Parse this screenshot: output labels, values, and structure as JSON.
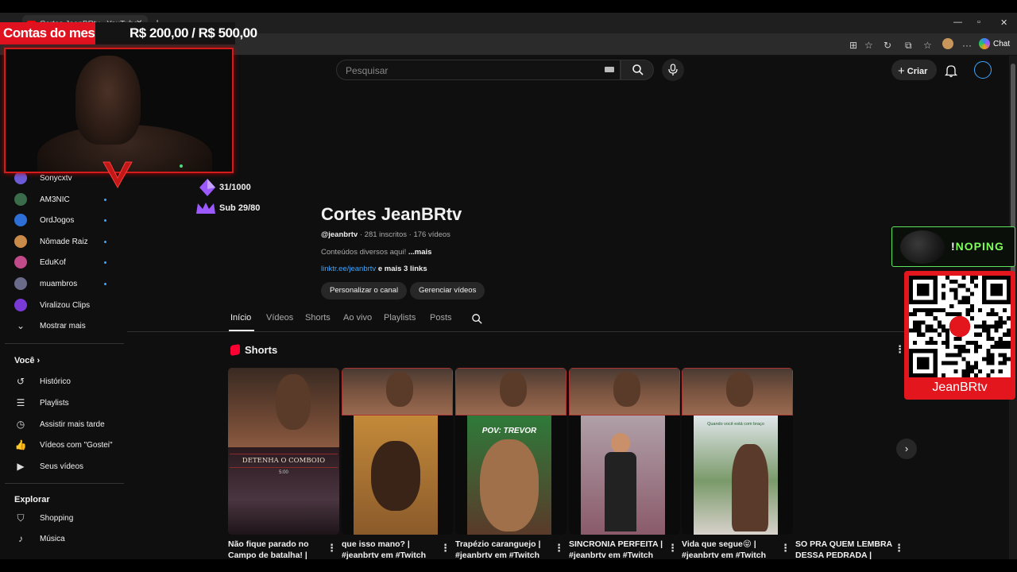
{
  "browser": {
    "tab_title": "Cortes JeanBRtv - YouTube",
    "chat_label": "Chat"
  },
  "overlay": {
    "bills_label": "Contas do mes",
    "bills_value": "R$ 200,00 / R$ 500,00",
    "goal_followers": "31/1000",
    "goal_subs": "Sub 29/80",
    "noping_label": "!NOPING",
    "noping_exclaim": "!",
    "noping_word": "NOPING",
    "qr_caption": "JeanBRtv"
  },
  "header": {
    "search_placeholder": "Pesquisar",
    "create_label": "Criar"
  },
  "sidebar": {
    "subscriptions": [
      {
        "name": "Sonycxtv",
        "color": "#6b5bd6"
      },
      {
        "name": "AM3NIC",
        "color": "#3a6b4a"
      },
      {
        "name": "OrdJogos",
        "color": "#2d6fd6"
      },
      {
        "name": "Nômade Raiz",
        "color": "#c98a4a"
      },
      {
        "name": "EduKof",
        "color": "#c04a8a"
      },
      {
        "name": "muambros",
        "color": "#6a6a8a"
      },
      {
        "name": "Viralizou Clips",
        "color": "#7a3ad6"
      }
    ],
    "show_more": "Mostrar mais",
    "you_heading": "Você",
    "you_items": [
      "Histórico",
      "Playlists",
      "Assistir mais tarde",
      "Vídeos com \"Gostei\"",
      "Seus vídeos"
    ],
    "explore_heading": "Explorar",
    "explore_items": [
      "Shopping",
      "Música"
    ]
  },
  "channel": {
    "name": "Cortes JeanBRtv",
    "handle": "@jeanbrtv",
    "meta": " · 281 inscritos · 176 vídeos",
    "description": "Conteúdos diversos aqui! ",
    "more": "...mais",
    "link": "linktr.ee/jeanbrtv",
    "more_links": " e mais 3 links",
    "customize_btn": "Personalizar o canal",
    "manage_btn": "Gerenciar vídeos"
  },
  "tabs": [
    "Início",
    "Vídeos",
    "Shorts",
    "Ao vivo",
    "Playlists",
    "Posts"
  ],
  "shorts_heading": "Shorts",
  "shorts": [
    {
      "title": "Não fique parado no Campo de batalha! |",
      "caption": "DETENHA O COMBOIO",
      "sub": "5:00"
    },
    {
      "title": "que isso mano? | #jeanbrtv em #Twitch",
      "caption": "",
      "sub": ""
    },
    {
      "title": "Trapézio caranguejo | #jeanbrtv em #Twitch",
      "caption": "POV: TREVOR",
      "sub": ""
    },
    {
      "title": "SINCRONIA PERFEITA | #jeanbrtv em #Twitch",
      "caption": "",
      "sub": ""
    },
    {
      "title": "Vida que segue😝 | #jeanbrtv em #Twitch",
      "caption": "Quando você está com braço",
      "sub": ""
    },
    {
      "title": "SO PRA QUEM LEMBRA DESSA PEDRADA |",
      "caption": "",
      "sub": ""
    }
  ]
}
